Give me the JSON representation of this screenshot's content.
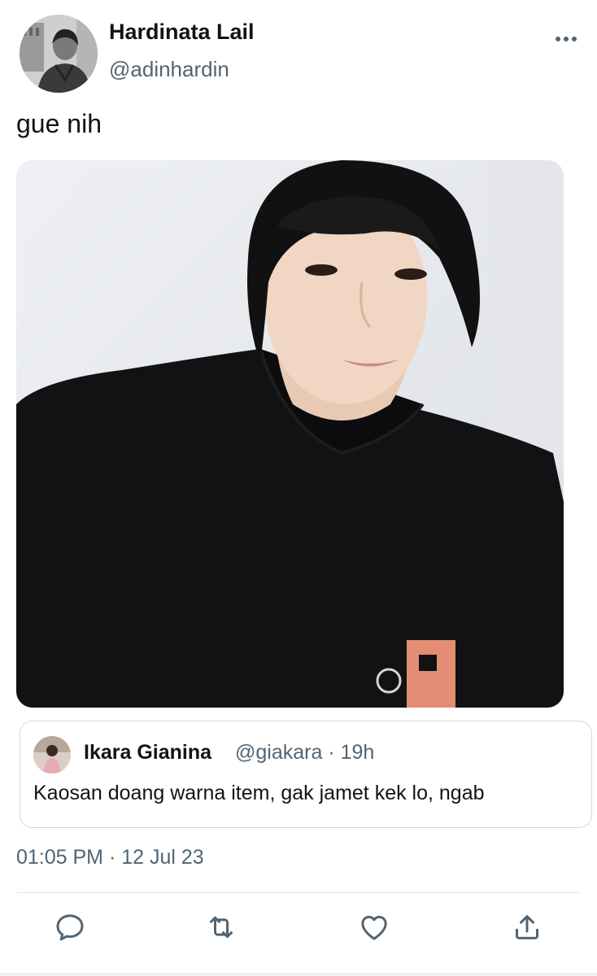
{
  "author": {
    "display_name": "Hardinata Lail",
    "handle": "@adinhardin"
  },
  "tweet": {
    "text": "gue nih",
    "timestamp": "01:05 PM · 12 Jul 23"
  },
  "quoted_tweet": {
    "display_name": "Ikara Gianina",
    "meta": "@giakara · 19h",
    "text": "Kaosan doang warna item, gak jamet kek lo, ngab"
  },
  "actions": {
    "icons": [
      "reply-icon",
      "retweet-icon",
      "like-icon",
      "share-icon"
    ],
    "more_icon": "more-icon"
  },
  "colors": {
    "text_primary": "#0f1419",
    "text_secondary": "#536471",
    "border": "#cfd9de"
  }
}
